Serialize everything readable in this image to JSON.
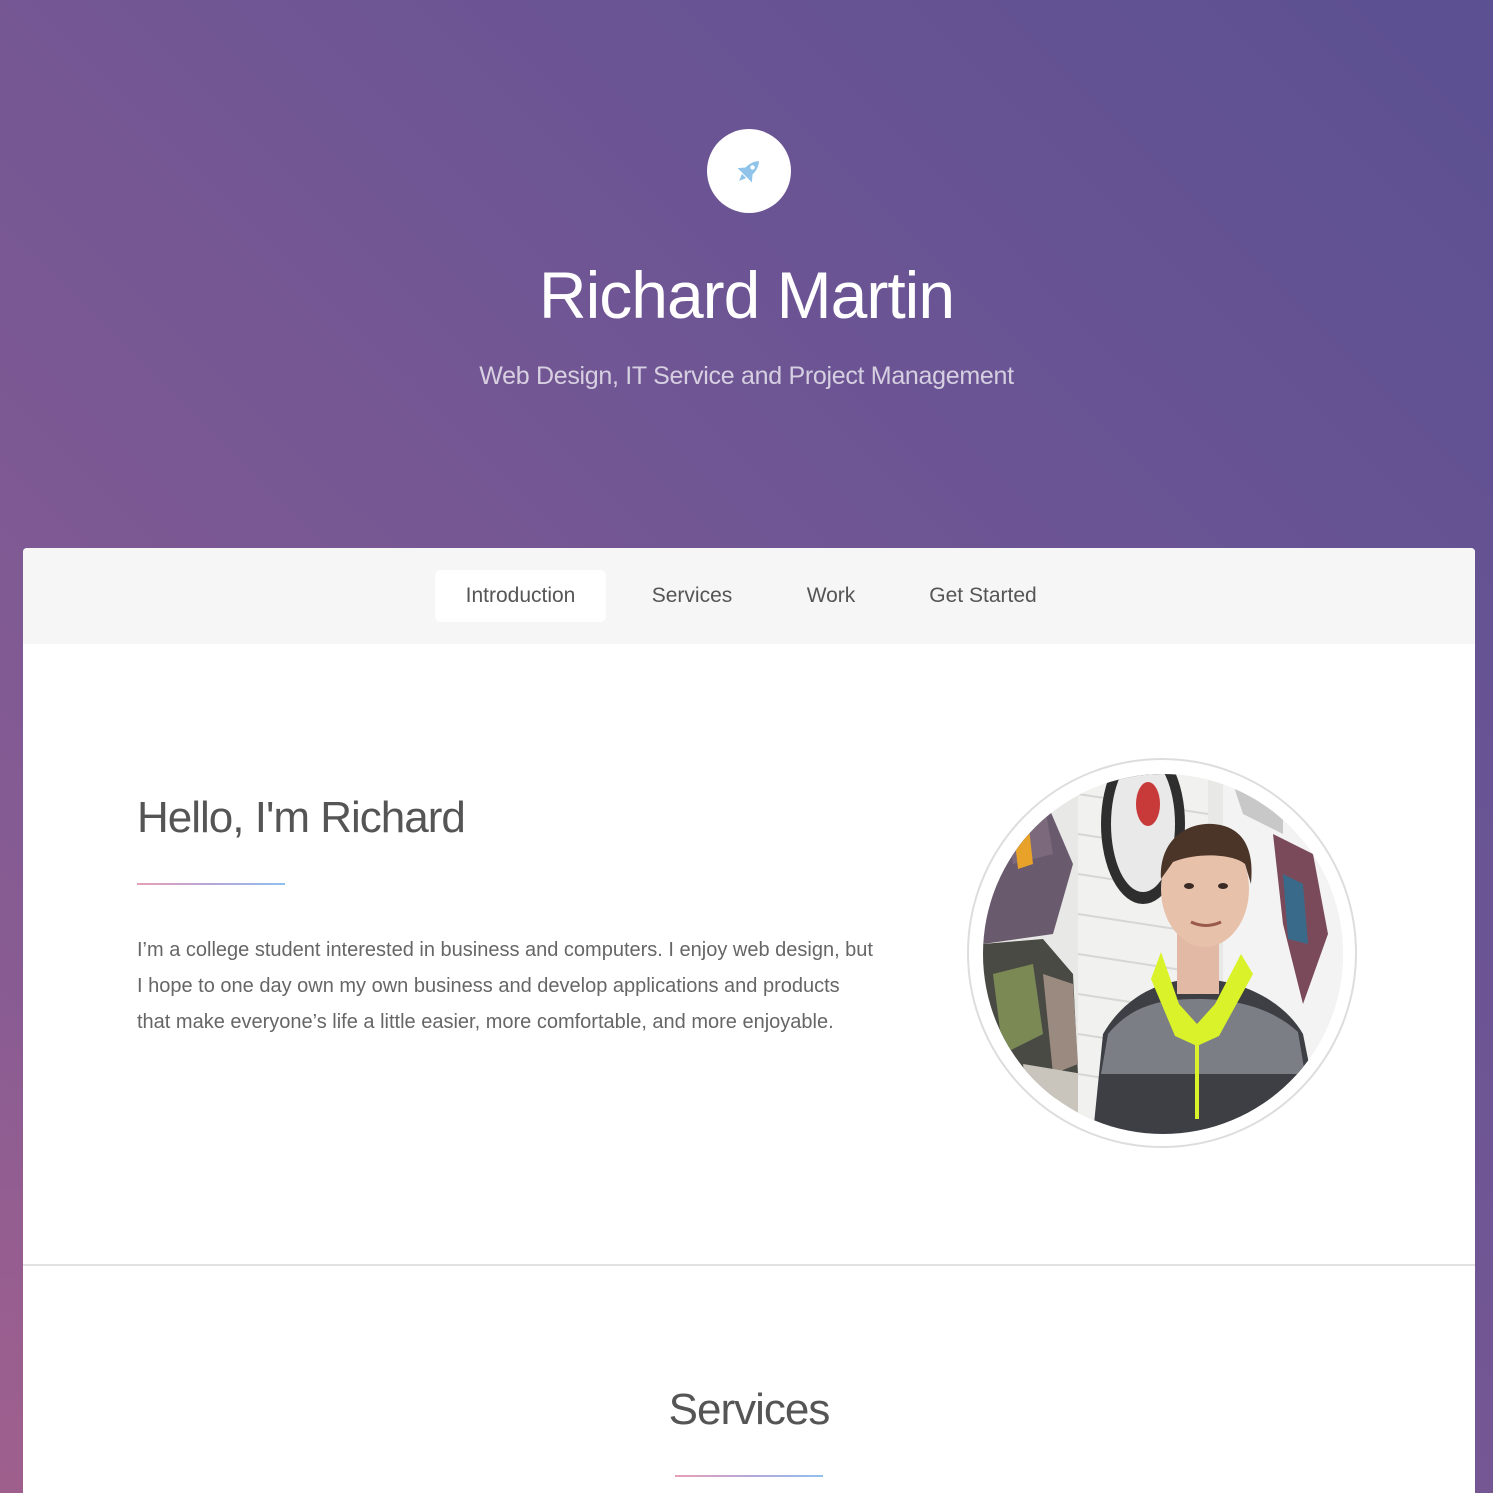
{
  "header": {
    "logo_icon": "rocket-icon",
    "title": "Richard Martin",
    "subtitle": "Web Design, IT Service and Project Management"
  },
  "nav": {
    "items": [
      {
        "label": "Introduction",
        "active": true
      },
      {
        "label": "Services",
        "active": false
      },
      {
        "label": "Work",
        "active": false
      },
      {
        "label": "Get Started",
        "active": false
      }
    ]
  },
  "intro": {
    "heading": "Hello, I'm Richard",
    "text": "I’m a college student interested in business and computers. I enjoy web design, but I hope to one day own my own business and develop applications and products that make everyone’s life a little easier, more comfortable, and more enjoyable."
  },
  "services": {
    "heading": "Services"
  },
  "colors": {
    "background_gradient_start": "#935f93",
    "background_gradient_end": "#5b5092",
    "logo_icon_color": "#8fc3ea",
    "accent_line_start": "#e7a0b6",
    "accent_line_end": "#8fc0ee"
  }
}
